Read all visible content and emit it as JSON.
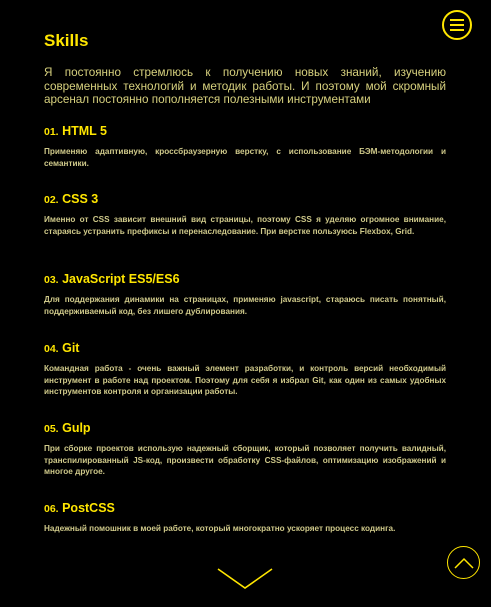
{
  "header": {
    "menu_icon": "menu-icon"
  },
  "section": {
    "title": "Skills",
    "intro": "Я постоянно стремлюсь к получению новых знаний, изучению современных технологий и методик работы. И поэтому мой скромный арсенал постоянно пополняется полезными инструментами"
  },
  "skills": [
    {
      "num": "01.",
      "name": "HTML 5",
      "desc": "Применяю адаптивную, кроссбраузерную верстку, с использование БЭМ-методологии и семантики."
    },
    {
      "num": "02.",
      "name": "CSS 3",
      "desc": "Именно от CSS зависит внешний вид страницы, поэтому CSS я уделяю огромное внимание, стараясь устранить префиксы и перенаследование. При верстке пользуюсь Flexbox, Grid."
    },
    {
      "num": "03.",
      "name": "JavaScript ES5/ES6",
      "desc": "Для поддержания динамики на страницах, применяю javascript, стараюсь писать понятный, поддерживаемый код, без лишего дублирования."
    },
    {
      "num": "04.",
      "name": "Git",
      "desc": "Командная работа - очень важный элемент разработки, и контроль версий необходимый инструмент в работе над проектом. Поэтому для себя я избрал Git, как один из самых удобных инструментов контроля и организации работы."
    },
    {
      "num": "05.",
      "name": "Gulp",
      "desc": "При сборке проектов использую надежный сборщик, который позволяет получить валидный, транспилированный JS-код, произвести обработку CSS-файлов, оптимизацию изображений и многое другое."
    },
    {
      "num": "06.",
      "name": "PostCSS",
      "desc": "Надежный помошник в моей работе, который многократно ускоряет процесс кодинга."
    }
  ],
  "controls": {
    "scroll_down_icon": "chevron-down-icon",
    "back_to_top_icon": "chevron-up-icon"
  },
  "colors": {
    "background": "#000000",
    "accent": "#ffe600",
    "text": "#d7d17e"
  }
}
